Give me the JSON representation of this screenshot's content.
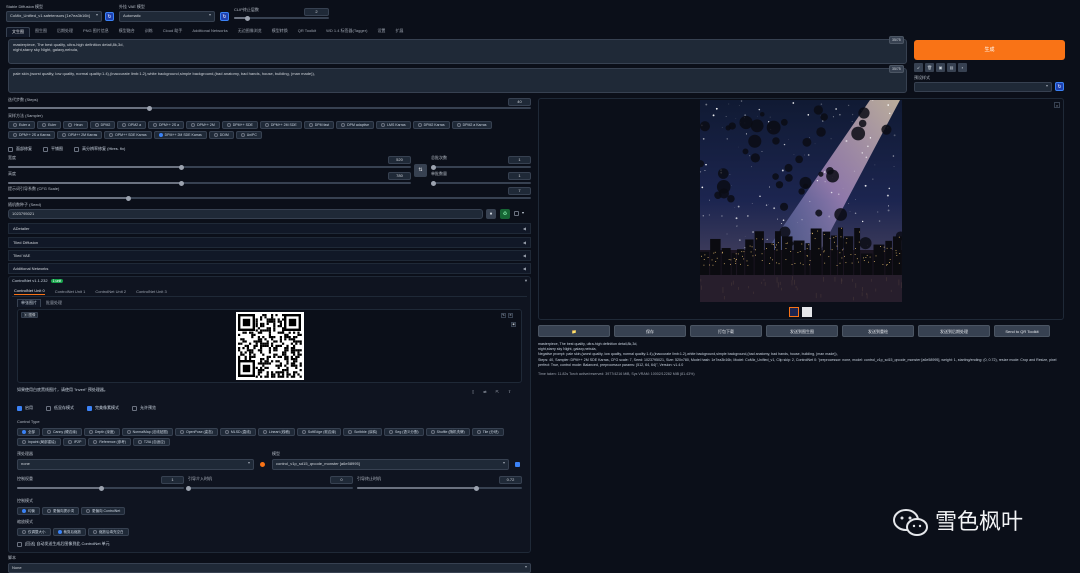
{
  "top": {
    "model_label": "Stable Diffusion 模型",
    "model_value": "CoMix_Unified_v1.safetensors [1e7ea3b16b]",
    "vae_label": "外挂 VAE 模型",
    "vae_value": "Automatic",
    "clip_label": "CLIP终止层数",
    "clip_value": "2"
  },
  "tabs": [
    "文生图",
    "图生图",
    "后期处理",
    "PNG 图片信息",
    "模型融合",
    "训练",
    "Cloud 助手",
    "Additional Networks",
    "无边图像浏览",
    "模型转换",
    "QR Toolkit",
    "WD 1.4 标签器(Tagger)",
    "设置",
    "扩展"
  ],
  "prompt": {
    "positive": "masterpiece, The best quality, ultra-high definition detail,8k,3d,\nnight,starry sky Night, galaxy,nebula,",
    "negative": "pale skin,(worst quality, low quality, normal quality:1.4),(inaccurate limb:1.2),white background,simple background,(bad anatomy, bad hands, house, building, (man made)),",
    "pos_count": "35/75",
    "neg_count": "35/75"
  },
  "generate_label": "生成",
  "style": {
    "label": "预设样式"
  },
  "steps": {
    "label": "迭代步数 (Steps)",
    "value": "40",
    "fraction": 0.27
  },
  "sampler": {
    "label": "采样方法 (Sampler)",
    "options": [
      "Euler a",
      "Euler",
      "Heun",
      "DPM2",
      "DPM2 a",
      "DPM++ 2S a",
      "DPM++ 2M",
      "DPM++ SDE",
      "DPM++ 2M SDE",
      "DPM fast",
      "DPM adaptive",
      "LMS Karras",
      "DPM2 Karras",
      "DPM2 a Karras",
      "DPM++ 2S a Karras",
      "DPM++ 2M Karras",
      "DPM++ SDE Karras",
      "DPM++ 2M SDE Karras",
      "DDIM",
      "UniPC"
    ],
    "selected": "DPM++ 2M SDE Karras"
  },
  "options": {
    "restore_faces": "面部修复",
    "tiling": "平铺图",
    "hires_fix": "高分辨率修复 (Hires. fix)"
  },
  "size": {
    "width_label": "宽度",
    "width_value": "520",
    "width_fraction": 0.43,
    "height_label": "高度",
    "height_value": "780",
    "height_fraction": 0.43,
    "batch_count_label": "总批次数",
    "batch_count_value": "1",
    "batch_size_label": "单批数量",
    "batch_size_value": "1",
    "swap": "⇅"
  },
  "cfg": {
    "label": "提示词引导系数 (CFG Scale)",
    "value": "7",
    "fraction": 0.23
  },
  "seed": {
    "label": "随机数种子 (Seed)",
    "value": "1023795021"
  },
  "accordions": [
    "ADetailer",
    "Tiled Diffusion",
    "Tiled VAE",
    "Additional Networks"
  ],
  "controlnet": {
    "title": "ControlNet v1.1.232",
    "badge": "1 unit",
    "units": [
      "ControlNet Unit 0",
      "ControlNet Unit 1",
      "ControlNet Unit 2",
      "ControlNet Unit 3"
    ],
    "subtabs": [
      "单张图片",
      "批量处理"
    ],
    "image_tag": "图像",
    "hint": "如果使用白底黑线图片，请使用 \"invert\" 预处理器。",
    "enable": "启用",
    "low_vram": "低显存模式",
    "pixel_perfect": "完美像素模式",
    "allow_preview": "允许预览",
    "control_type_label": "Control Type",
    "control_types": [
      "全部",
      "Canny (硬边缘)",
      "Depth (深度)",
      "NormalMap (法线贴图)",
      "OpenPose (姿态)",
      "MLSD (直线)",
      "Lineart (线稿)",
      "SoftEdge (软边缘)",
      "Scribble (涂鸦)",
      "Seg (语义分割)",
      "Shuffle (随机洗牌)",
      "Tile (分块)",
      "Inpaint (局部重绘)",
      "IP2P",
      "Reference (参考)",
      "T2IA (自适应)"
    ],
    "preprocessor_label": "预处理器",
    "preprocessor_value": "none",
    "model_label": "模型",
    "model_value": "control_v1p_sd15_qrcode_monster [a6e58995]",
    "weight_label": "控制权重",
    "weight_value": "1",
    "weight_fraction": 0.5,
    "start_label": "引导介入时机",
    "start_value": "0",
    "start_fraction": 0.0,
    "end_label": "引导终止时机",
    "end_value": "0.72",
    "end_fraction": 0.72,
    "control_mode_label": "控制模式",
    "control_modes": [
      "均衡",
      "更偏向提示词",
      "更偏向 ControlNet"
    ],
    "resize_mode_label": "缩放模式",
    "resize_modes": [
      "仅调整大小",
      "裁剪后缩放",
      "缩放后填充空白"
    ],
    "loopback": "[回送] 自动发送生成后图像到此 ControlNet 单元"
  },
  "script": {
    "label": "脚本",
    "value": "None"
  },
  "output": {
    "buttons": [
      "📁",
      "保存",
      "打包下载",
      "发送到图生图",
      "发送到重绘",
      "发送到后期处理",
      "Send to QR Toolkit"
    ],
    "info_prompt": "masterpiece, The best quality, ultra-high definition detail,8k,3d,\nnight,starry sky Night, galaxy,nebula,",
    "info_negative": "Negative prompt: pale skin,(worst quality, low quality, normal quality:1.4),(inaccurate limb:1.2),white background,simple background,(bad anatomy, bad hands, house, building, (man made)),",
    "info_params": "Steps: 40, Sampler: DPM++ 2M SDE Karras, CFG scale: 7, Seed: 1023795021, Size: 520x780, Model hash: 1e7ea3b16b, Model: CoMix_Unified_v1, Clip skip: 2, ControlNet 0: \"preprocessor: none, model: control_v1p_sd15_qrcode_monster [a6e58995], weight: 1, starting/ending: (0, 0.72), resize mode: Crop and Resize, pixel perfect: True, control mode: Balanced, preprocessor params: (512, 64, 64)\", Version: v1.4.0",
    "info_time": "Time taken: 11.82s  Torch active/reserved: 3977/4216 MiB, Sys VRAM: 10002/12282 MiB (81.43%)"
  },
  "watermark": "雪色枫叶"
}
